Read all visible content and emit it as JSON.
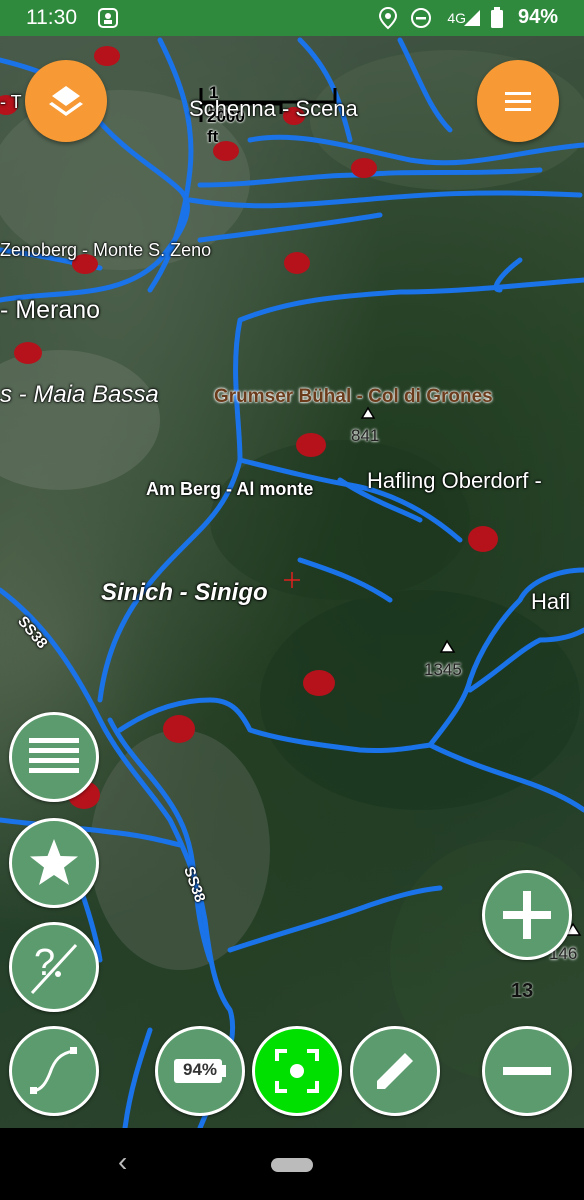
{
  "status_bar": {
    "time": "11:30",
    "network": "4G",
    "battery_percent": "94%",
    "icons": [
      "app-notification-icon",
      "location-icon",
      "do-not-disturb-icon",
      "signal-icon",
      "battery-icon"
    ]
  },
  "map": {
    "scale": {
      "km": "1 km",
      "ft": "2000 ft"
    },
    "zoom_level": "13",
    "places": {
      "schenna": "Schenna - Scena",
      "zenoberg": "Zenoberg - Monte S. Zeno",
      "merano": "- Merano",
      "maia_bassa": "s - Maia Bassa",
      "grumser": "Grumser Bühal - Col di Grones",
      "am_berg": "Am Berg - Al monte",
      "hafling_oberdorf": "Hafling Oberdorf -",
      "sinich": "Sinich - Sinigo",
      "hafl": "Hafl",
      "top_left": "- T"
    },
    "peaks": {
      "p841": "841",
      "p1345": "1345",
      "p146": "146"
    },
    "roads": {
      "ss38_a": "SS38",
      "ss38_b": "SS38"
    },
    "colors": {
      "rivers": "#1a73e8",
      "markers": "#b5121b",
      "fab_orange": "#f79a35",
      "fab_green": "#5b9b6d",
      "fab_lime": "#00e000"
    }
  },
  "buttons": {
    "layers": "layers-icon",
    "menu": "hamburger-menu-icon",
    "list": "list-icon",
    "favorites": "star-icon",
    "search": "help-search-icon",
    "route": "route-icon",
    "battery_label": "94%",
    "center": "center-location-icon",
    "edit": "pencil-icon",
    "zoom_in": "plus-icon",
    "zoom_out": "minus-icon"
  }
}
